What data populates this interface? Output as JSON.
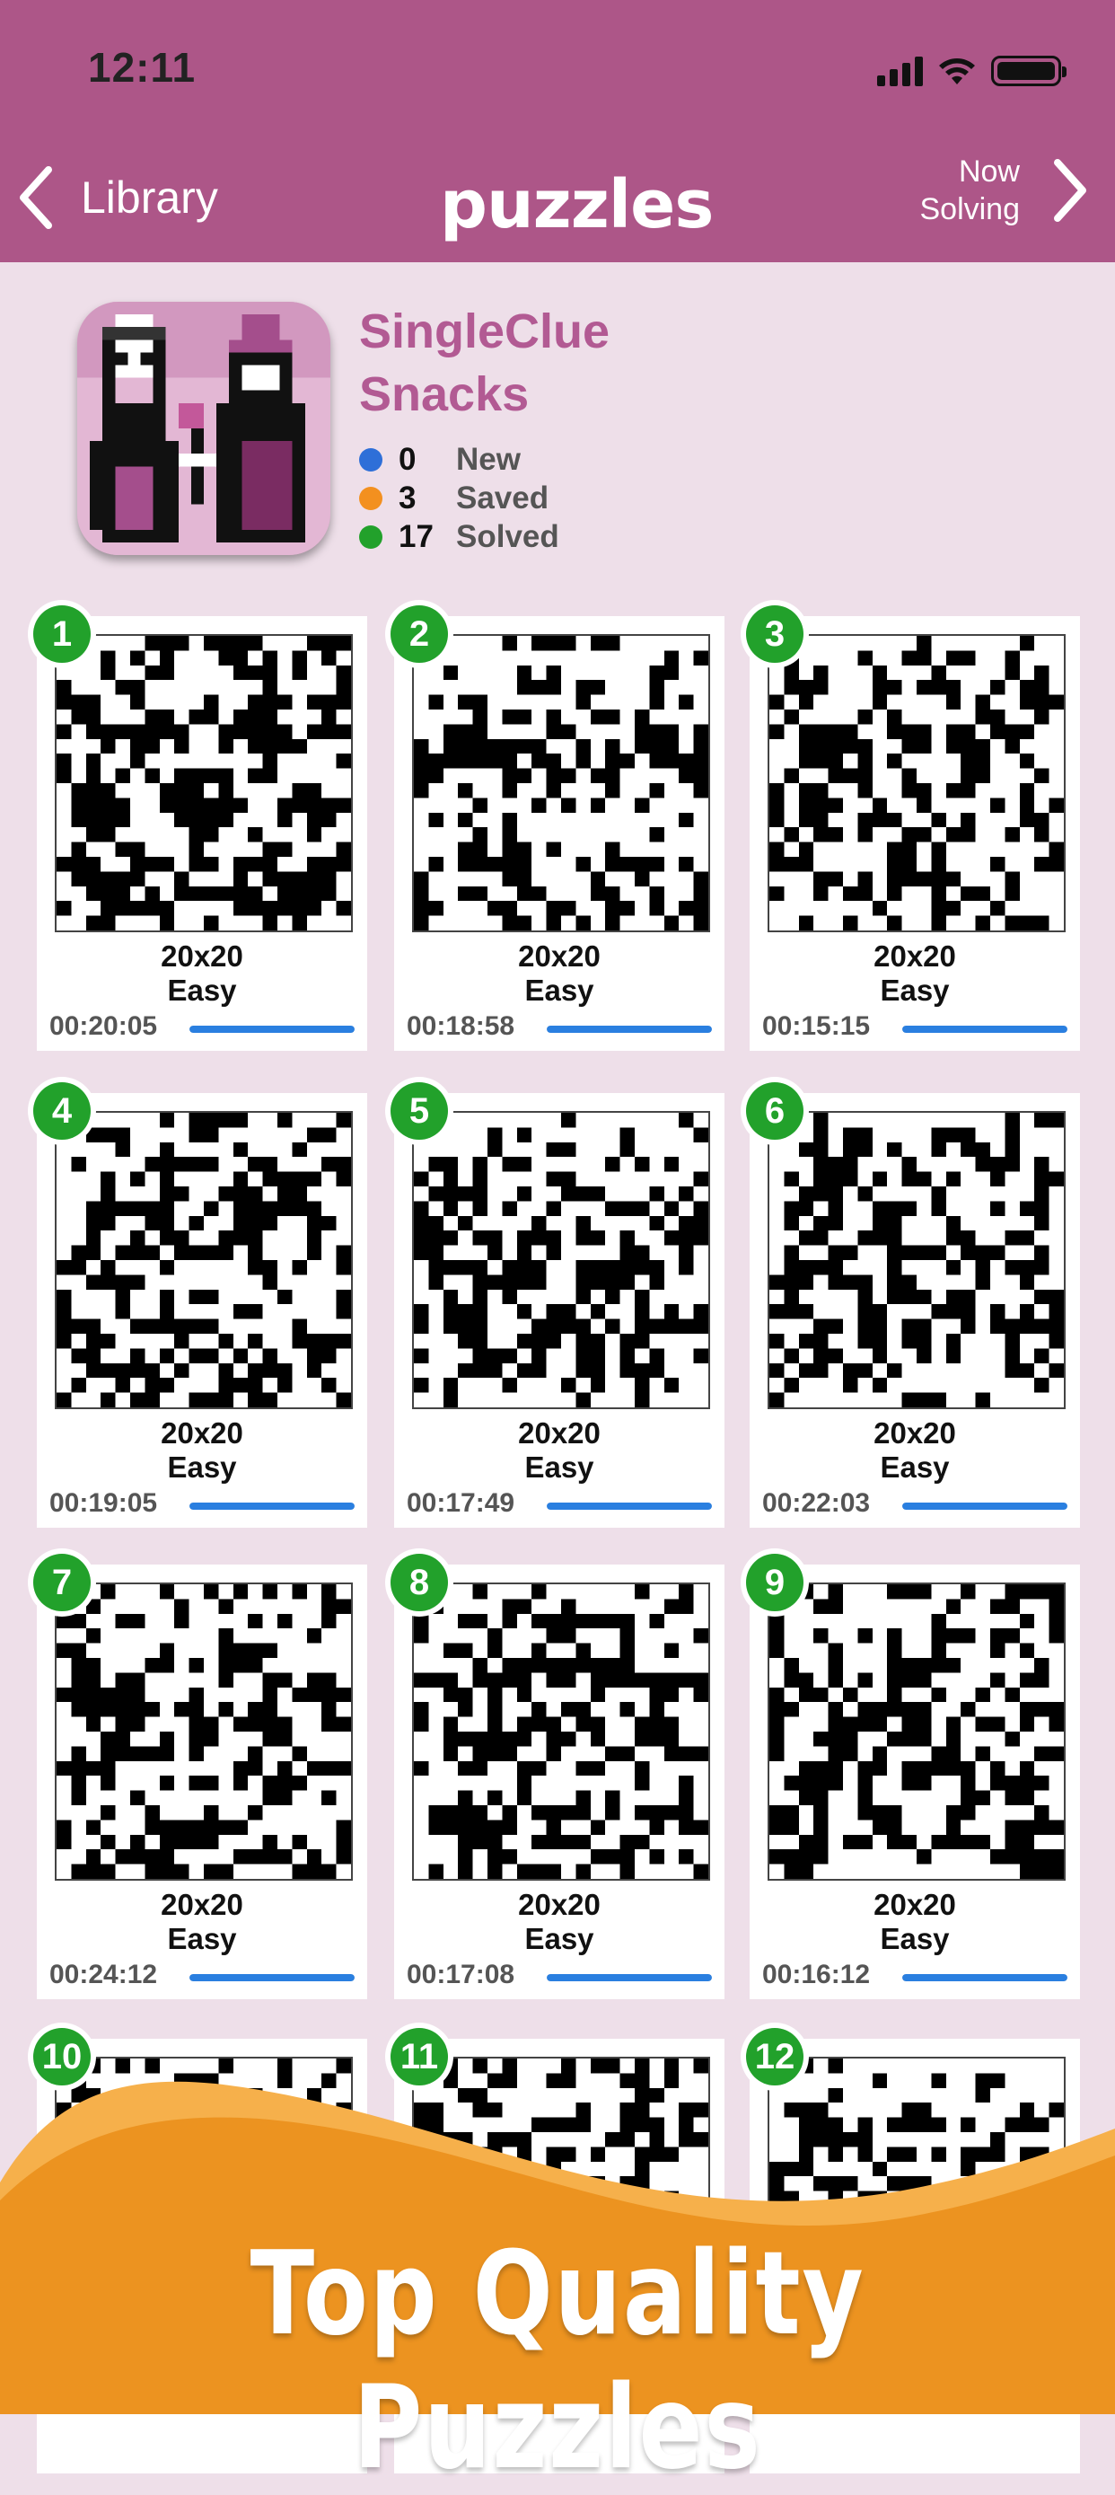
{
  "status": {
    "time": "12:11"
  },
  "nav": {
    "back_label": "Library",
    "logo": "puzzles",
    "now_solving": "Now Solving",
    "now_line1": "Now",
    "now_line2": "Solving"
  },
  "pack": {
    "title_line1": "SingleClue",
    "title_line2": "Snacks",
    "stats": [
      {
        "count": "0",
        "label": "New",
        "color": "#2e6fd8"
      },
      {
        "count": "3",
        "label": "Saved",
        "color": "#f3901f"
      },
      {
        "count": "17",
        "label": "Solved",
        "color": "#22a12b"
      }
    ]
  },
  "puzzles": [
    {
      "number": "1",
      "size": "20x20",
      "difficulty": "Easy",
      "time": "00:20:05",
      "progress": 1
    },
    {
      "number": "2",
      "size": "20x20",
      "difficulty": "Easy",
      "time": "00:18:58",
      "progress": 1
    },
    {
      "number": "3",
      "size": "20x20",
      "difficulty": "Easy",
      "time": "00:15:15",
      "progress": 1
    },
    {
      "number": "4",
      "size": "20x20",
      "difficulty": "Easy",
      "time": "00:19:05",
      "progress": 1
    },
    {
      "number": "5",
      "size": "20x20",
      "difficulty": "Easy",
      "time": "00:17:49",
      "progress": 1
    },
    {
      "number": "6",
      "size": "20x20",
      "difficulty": "Easy",
      "time": "00:22:03",
      "progress": 1
    },
    {
      "number": "7",
      "size": "20x20",
      "difficulty": "Easy",
      "time": "00:24:12",
      "progress": 1
    },
    {
      "number": "8",
      "size": "20x20",
      "difficulty": "Easy",
      "time": "00:17:08",
      "progress": 1
    },
    {
      "number": "9",
      "size": "20x20",
      "difficulty": "Easy",
      "time": "00:16:12",
      "progress": 1
    },
    {
      "number": "10"
    },
    {
      "number": "11"
    },
    {
      "number": "12"
    }
  ],
  "banner": {
    "text": "Top Quality Puzzles",
    "color": "#ec9320"
  },
  "colors": {
    "nav": "#ad5688",
    "background": "#eedfe9",
    "accent_title": "#b25a93",
    "progress": "#2a7fe0",
    "badge": "#22a12b"
  }
}
